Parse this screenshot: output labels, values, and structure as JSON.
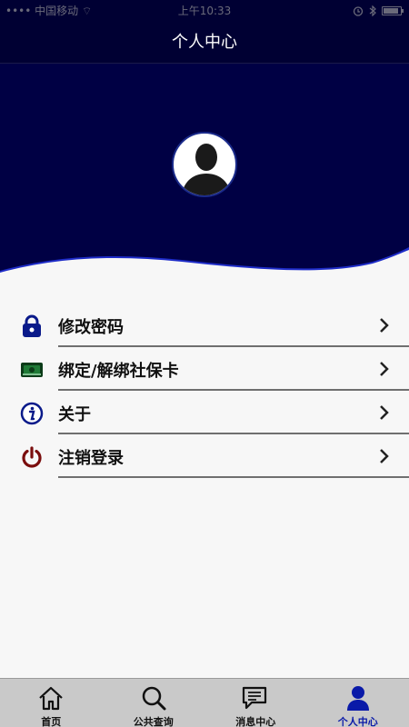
{
  "status_bar": {
    "carrier": "•••• 中国移动 ⌔",
    "time": "上午10:33",
    "icons": [
      "alarm-icon",
      "bluetooth-icon",
      "battery-icon"
    ]
  },
  "nav": {
    "title": "个人中心"
  },
  "colors": {
    "header": "#000044",
    "accent": "#0a1aa8",
    "tab_bar": "#c9c9c9"
  },
  "menu": [
    {
      "label": "修改密码",
      "icon": "lock-icon"
    },
    {
      "label": "绑定/解绑社保卡",
      "icon": "card-icon"
    },
    {
      "label": "关于",
      "icon": "info-icon"
    },
    {
      "label": "注销登录",
      "icon": "power-icon"
    }
  ],
  "tabs": [
    {
      "label": "首页",
      "icon": "home-icon",
      "active": false
    },
    {
      "label": "公共查询",
      "icon": "search-icon",
      "active": false
    },
    {
      "label": "消息中心",
      "icon": "message-icon",
      "active": false
    },
    {
      "label": "个人中心",
      "icon": "person-icon",
      "active": true
    }
  ]
}
